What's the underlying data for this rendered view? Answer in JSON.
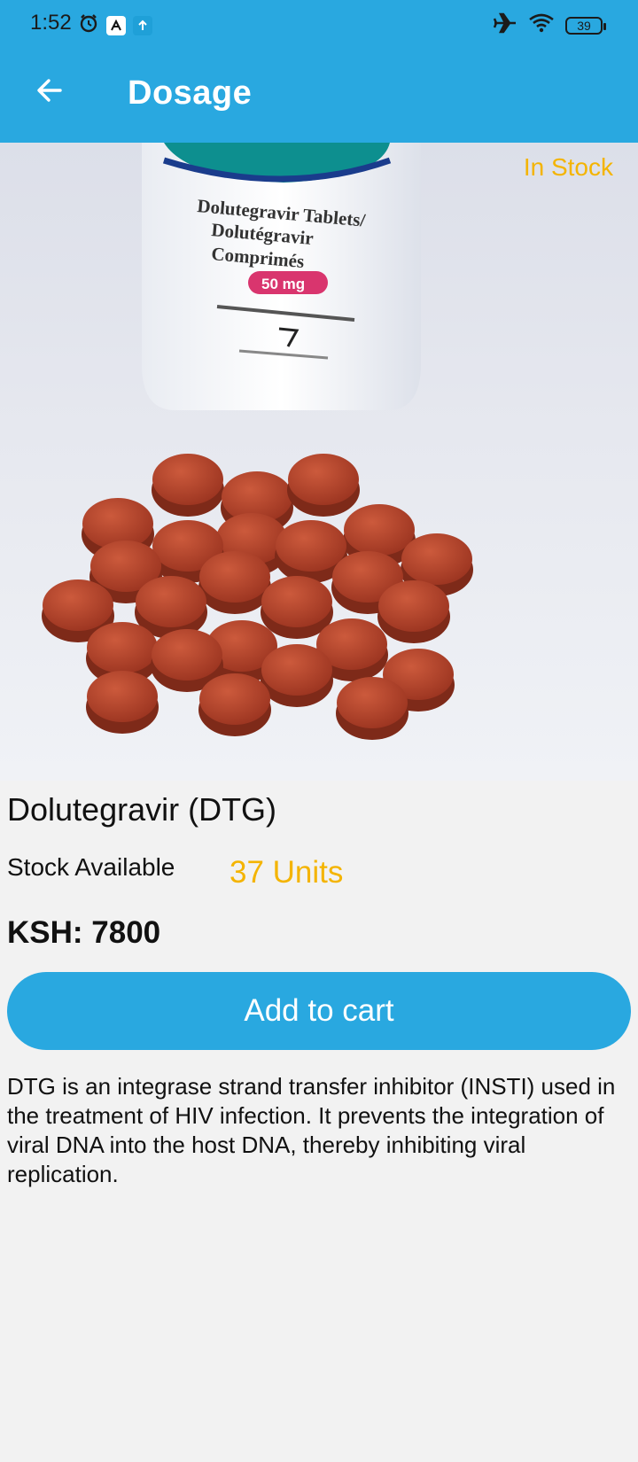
{
  "status_bar": {
    "time": "1:52",
    "battery": "39"
  },
  "app_bar": {
    "title": "Dosage"
  },
  "product": {
    "stock_badge": "In Stock",
    "name": "Dolutegravir (DTG)",
    "stock_label": "Stock Available",
    "stock_value": "37 Units",
    "price": "KSH: 7800",
    "add_button": "Add to cart",
    "description": "DTG is an integrase strand transfer inhibitor (INSTI) used in the treatment of HIV infection. It prevents the integration of viral DNA into the host DNA, thereby inhibiting viral replication.",
    "image": {
      "bottle_text": [
        "Dolutegravir Tablets/",
        "Dolutégravir",
        "Comprimés"
      ],
      "dose": "50 mg"
    }
  },
  "colors": {
    "primary": "#29a8e0",
    "accent": "#f4b400",
    "pill": "#b8432a"
  },
  "icons": [
    "alarm-icon",
    "app-notification-icon",
    "upload-icon",
    "airplane-icon",
    "wifi-icon",
    "battery-icon",
    "back-arrow-icon"
  ]
}
